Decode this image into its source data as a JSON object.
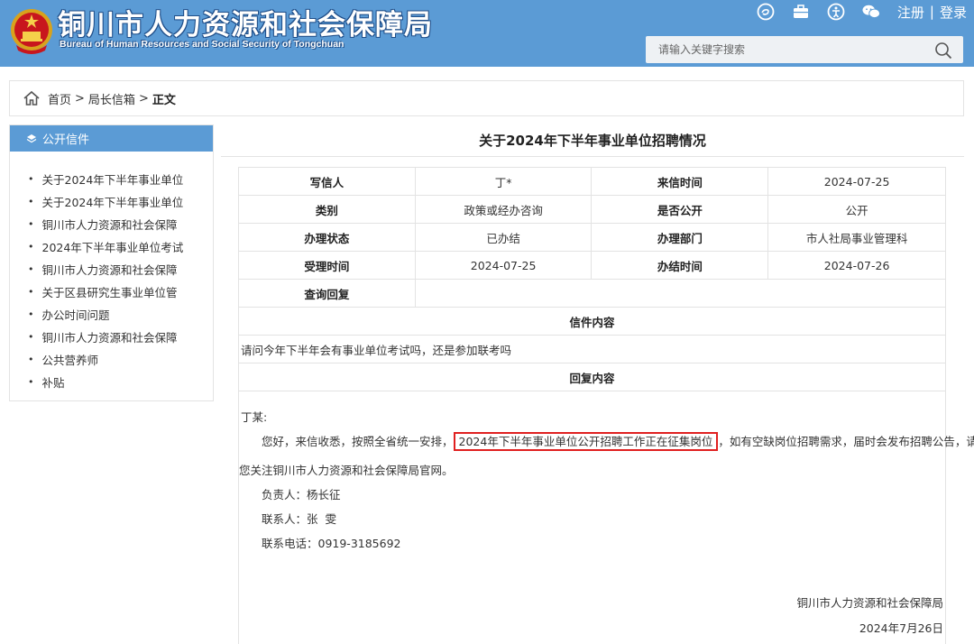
{
  "header": {
    "title": "铜川市人力资源和社会保障局",
    "subtitle": "Bureau of Human Resources and Social Security of Tongchuan",
    "register": "注册",
    "divider": "|",
    "login": "登录",
    "icons": [
      "weibo-icon",
      "briefcase-icon",
      "accessibility-icon",
      "wechat-icon"
    ],
    "search_placeholder": "请输入关键字搜索"
  },
  "breadcrumb": {
    "home": "首页",
    "sep": ">",
    "section": "局长信箱",
    "current": "正文"
  },
  "sidebar": {
    "heading": "公开信件",
    "items": [
      "关于2024年下半年事业单位",
      "关于2024年下半年事业单位",
      "铜川市人力资源和社会保障",
      "2024年下半年事业单位考试",
      "铜川市人力资源和社会保障",
      "关于区县研究生事业单位管",
      "办公时间问题",
      "铜川市人力资源和社会保障",
      "公共营养师",
      "补贴"
    ]
  },
  "article": {
    "title": "关于2024年下半年事业单位招聘情况",
    "rows": [
      {
        "l1": "写信人",
        "v1": "丁*",
        "l2": "来信时间",
        "v2": "2024-07-25"
      },
      {
        "l1": "类别",
        "v1": "政策或经办咨询",
        "l2": "是否公开",
        "v2": "公开"
      },
      {
        "l1": "办理状态",
        "v1": "已办结",
        "l2": "办理部门",
        "v2": "市人社局事业管理科"
      },
      {
        "l1": "受理时间",
        "v1": "2024-07-25",
        "l2": "办结时间",
        "v2": "2024-07-26"
      }
    ],
    "query_reply_label": "查询回复",
    "letter_content_label": "信件内容",
    "letter_content": "请问今年下半年会有事业单位考试吗，还是参加联考吗",
    "reply_content_label": "回复内容",
    "reply": {
      "salutation": "丁某:",
      "line1_before": "您好，来信收悉，按照全省统一安排，",
      "line1_highlight": "2024年下半年事业单位公开招聘工作正在征集岗位",
      "line1_after": "，如有空缺岗位招聘需求，届时会发布招聘公告，请",
      "line2": "您关注铜川市人力资源和社会保障局官网。",
      "person": "负责人：杨长征",
      "contact": "联系人：张  雯",
      "phone": "联系电话：0919-3185692",
      "org": "铜川市人力资源和社会保障局",
      "date": "2024年7月26日"
    }
  }
}
